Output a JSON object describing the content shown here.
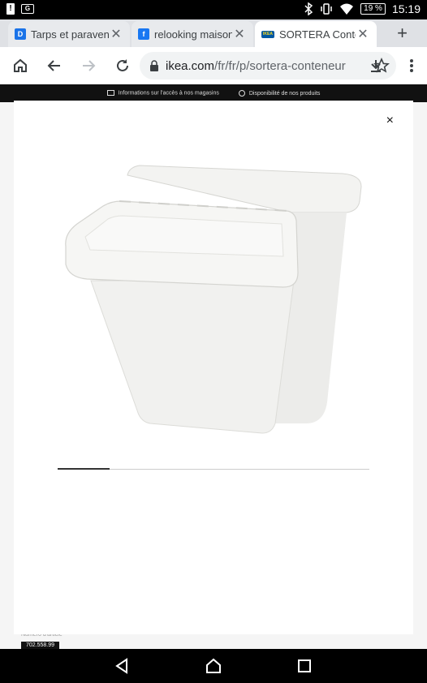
{
  "status_bar": {
    "left_icons": [
      "alert-icon",
      "gmail-icon"
    ],
    "battery": "19 %",
    "time": "15:19",
    "icons": [
      "bluetooth-icon",
      "vibrate-icon",
      "wifi-icon",
      "battery-icon"
    ]
  },
  "tabs": [
    {
      "title": "Tarps et paravent",
      "favicon": "D",
      "favicon_color": "#1a73e8",
      "active": false
    },
    {
      "title": "relooking maison",
      "favicon": "f",
      "favicon_color": "#1877f2",
      "active": false
    },
    {
      "title": "SORTERA Conteneur",
      "favicon": "IKEA",
      "favicon_color": "#0058a3",
      "active": true
    }
  ],
  "toolbar": {
    "url_host": "ikea.com",
    "url_path": "/fr/fr/p/sortera-conteneur"
  },
  "page": {
    "info_access": "Informations sur l'accès à nos magasins",
    "info_availability": "Disponibilité de nos produits",
    "behind_label": "Numéro d'article",
    "article_number": "702.558.99"
  },
  "modal": {
    "close_label": "×",
    "image_alt": "SORTERA",
    "carousel": {
      "total": 6,
      "current": 1
    }
  },
  "colors": {
    "accent": "#0058a3",
    "chrome_bg": "#dfe1e5"
  }
}
